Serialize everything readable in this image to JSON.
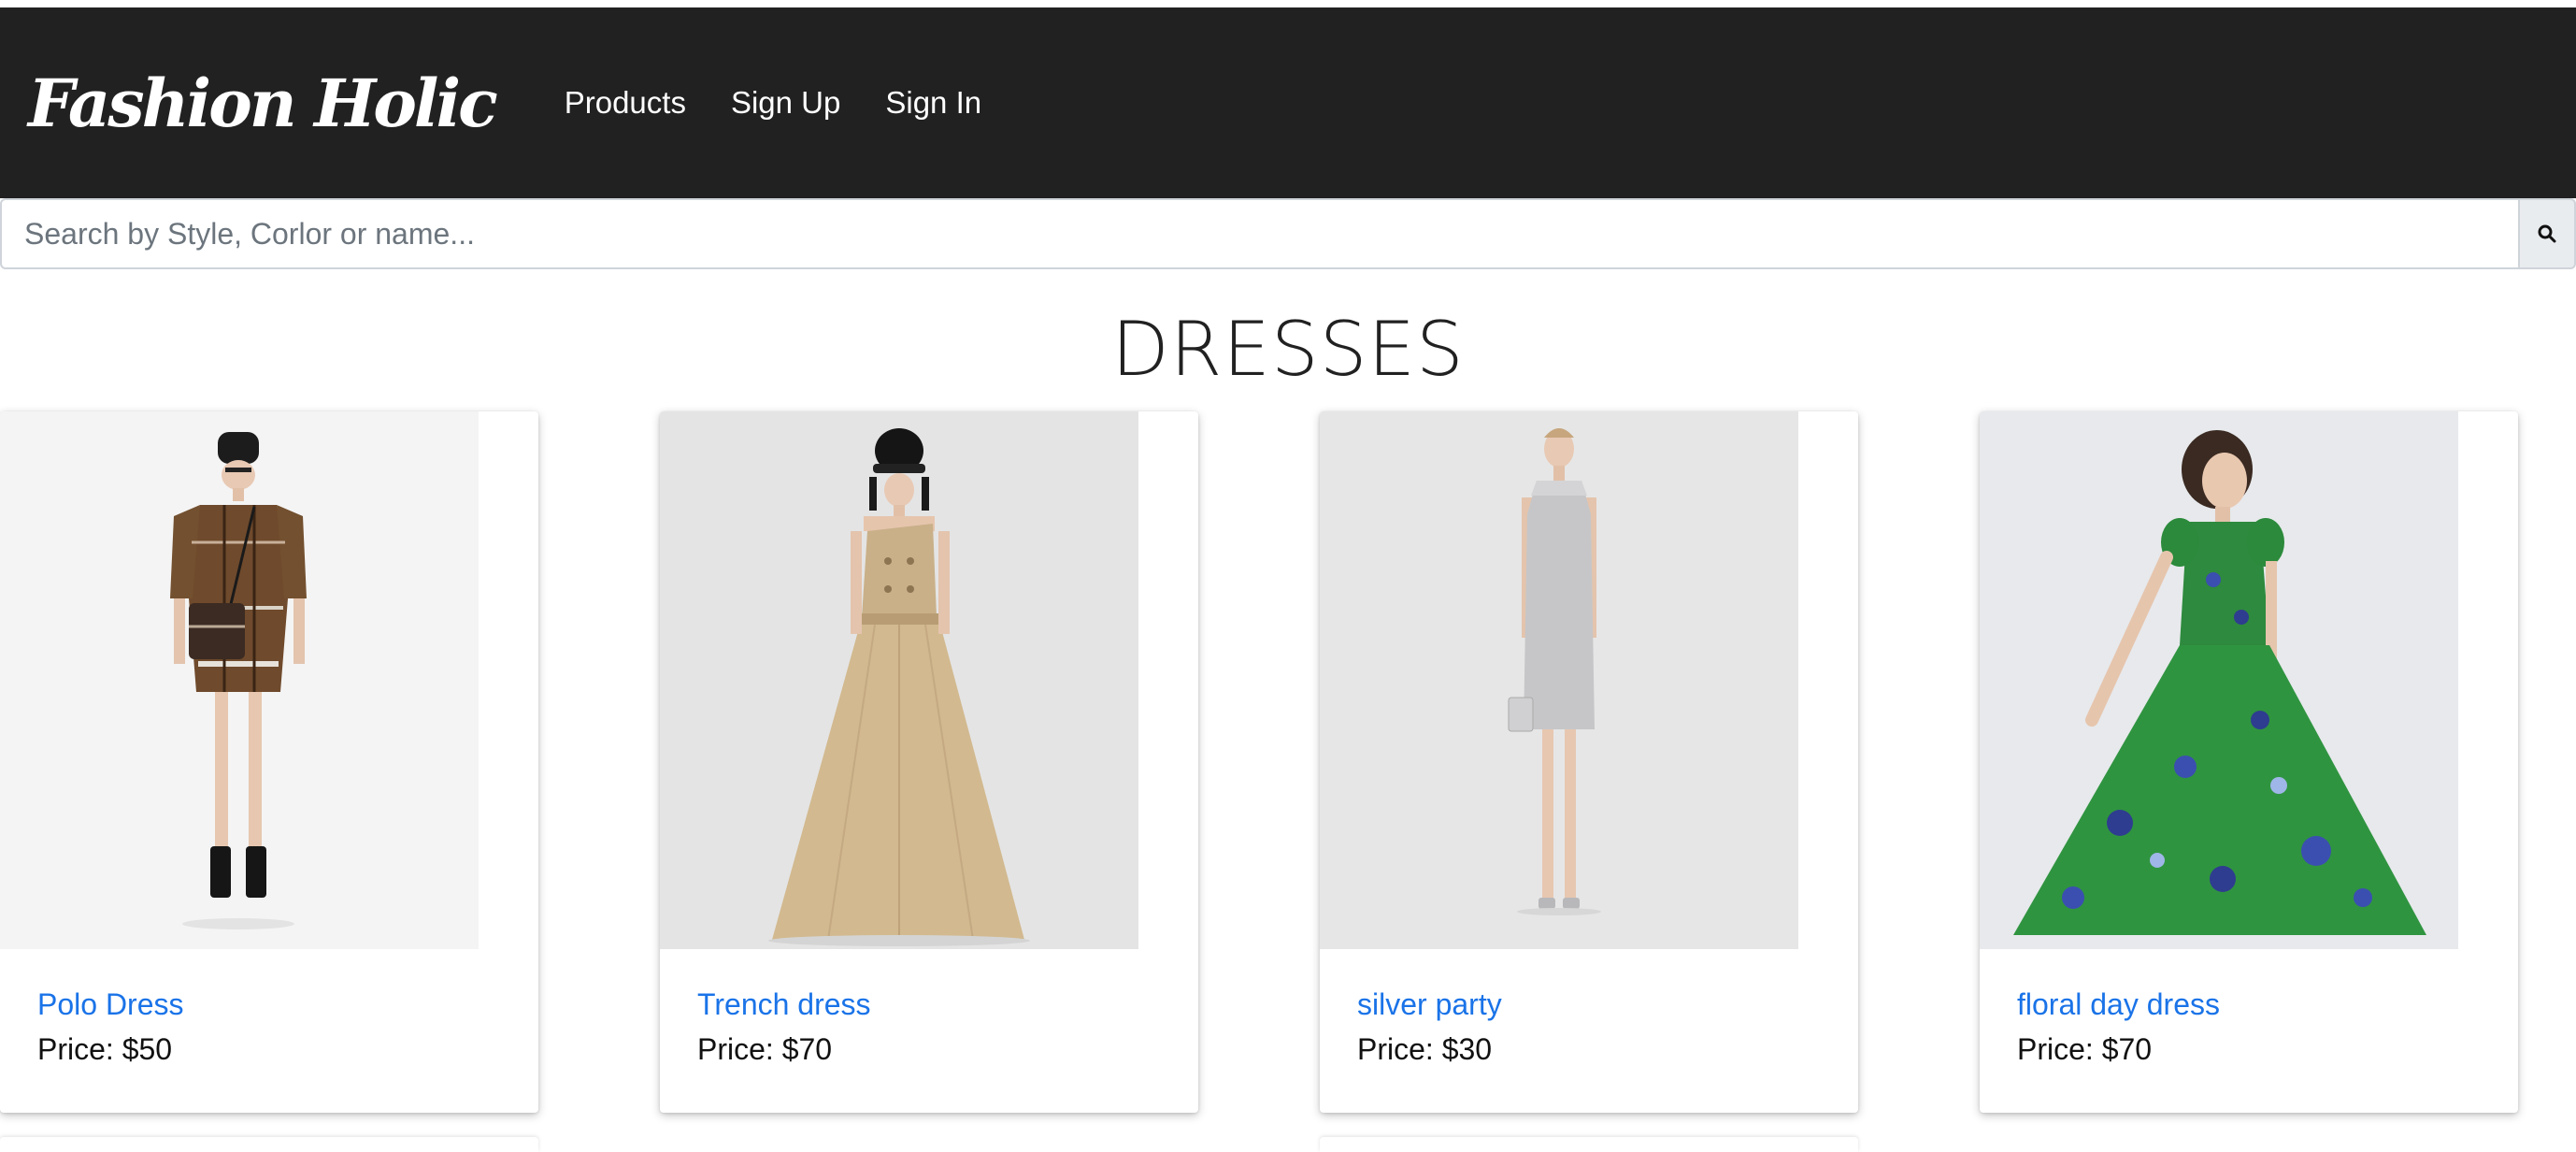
{
  "navbar": {
    "brand": "Fashion Holic",
    "links": [
      "Products",
      "Sign Up",
      "Sign In"
    ]
  },
  "search": {
    "placeholder": "Search by Style, Corlor or name...",
    "value": "",
    "icon": "search-icon"
  },
  "page": {
    "title": "DRESSES"
  },
  "products": [
    {
      "name": "Polo Dress",
      "price_label": "Price:",
      "price": "$50"
    },
    {
      "name": "Trench dress",
      "price_label": "Price:",
      "price": "$70"
    },
    {
      "name": "silver party",
      "price_label": "Price:",
      "price": "$30"
    },
    {
      "name": "floral day dress",
      "price_label": "Price:",
      "price": "$70"
    }
  ],
  "colors": {
    "navbar_bg": "#212121",
    "link": "#1a73e8",
    "text": "#111111"
  }
}
